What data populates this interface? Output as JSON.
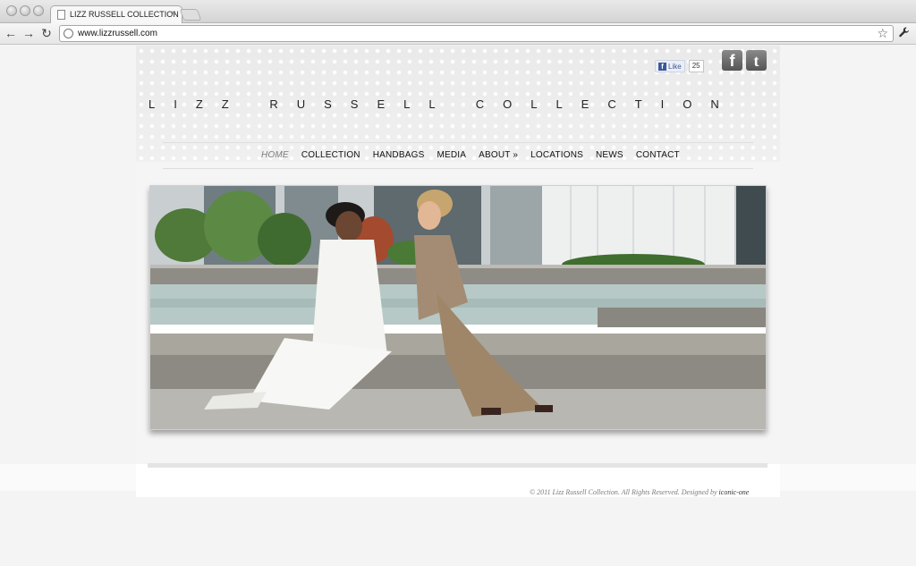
{
  "browser": {
    "tab_title": "LIZZ RUSSELL COLLECTION",
    "tab_close": "×",
    "url": "www.lizzrussell.com",
    "back": "←",
    "forward": "→",
    "reload": "↻",
    "bookmark_star": "☆",
    "wrench": "🔧"
  },
  "social": {
    "like_label": "Like",
    "like_count": "25",
    "facebook_glyph": "f",
    "twitter_glyph": "t"
  },
  "brand": {
    "logo": "LIZZ RUSSELL COLLECTION"
  },
  "nav": {
    "items": [
      "HOME",
      "COLLECTION",
      "HANDBAGS",
      "MEDIA",
      "ABOUT »",
      "LOCATIONS",
      "NEWS",
      "CONTACT"
    ],
    "active": "HOME"
  },
  "footer": {
    "copyright": "© 2011 Lizz Russell Collection. All Rights Reserved. Designed by ",
    "designer": "iconic-one"
  },
  "colors": {
    "nav_active": "#7b7b7b",
    "fb_blue": "#3b5998",
    "footer_text": "#7b7b7b"
  }
}
